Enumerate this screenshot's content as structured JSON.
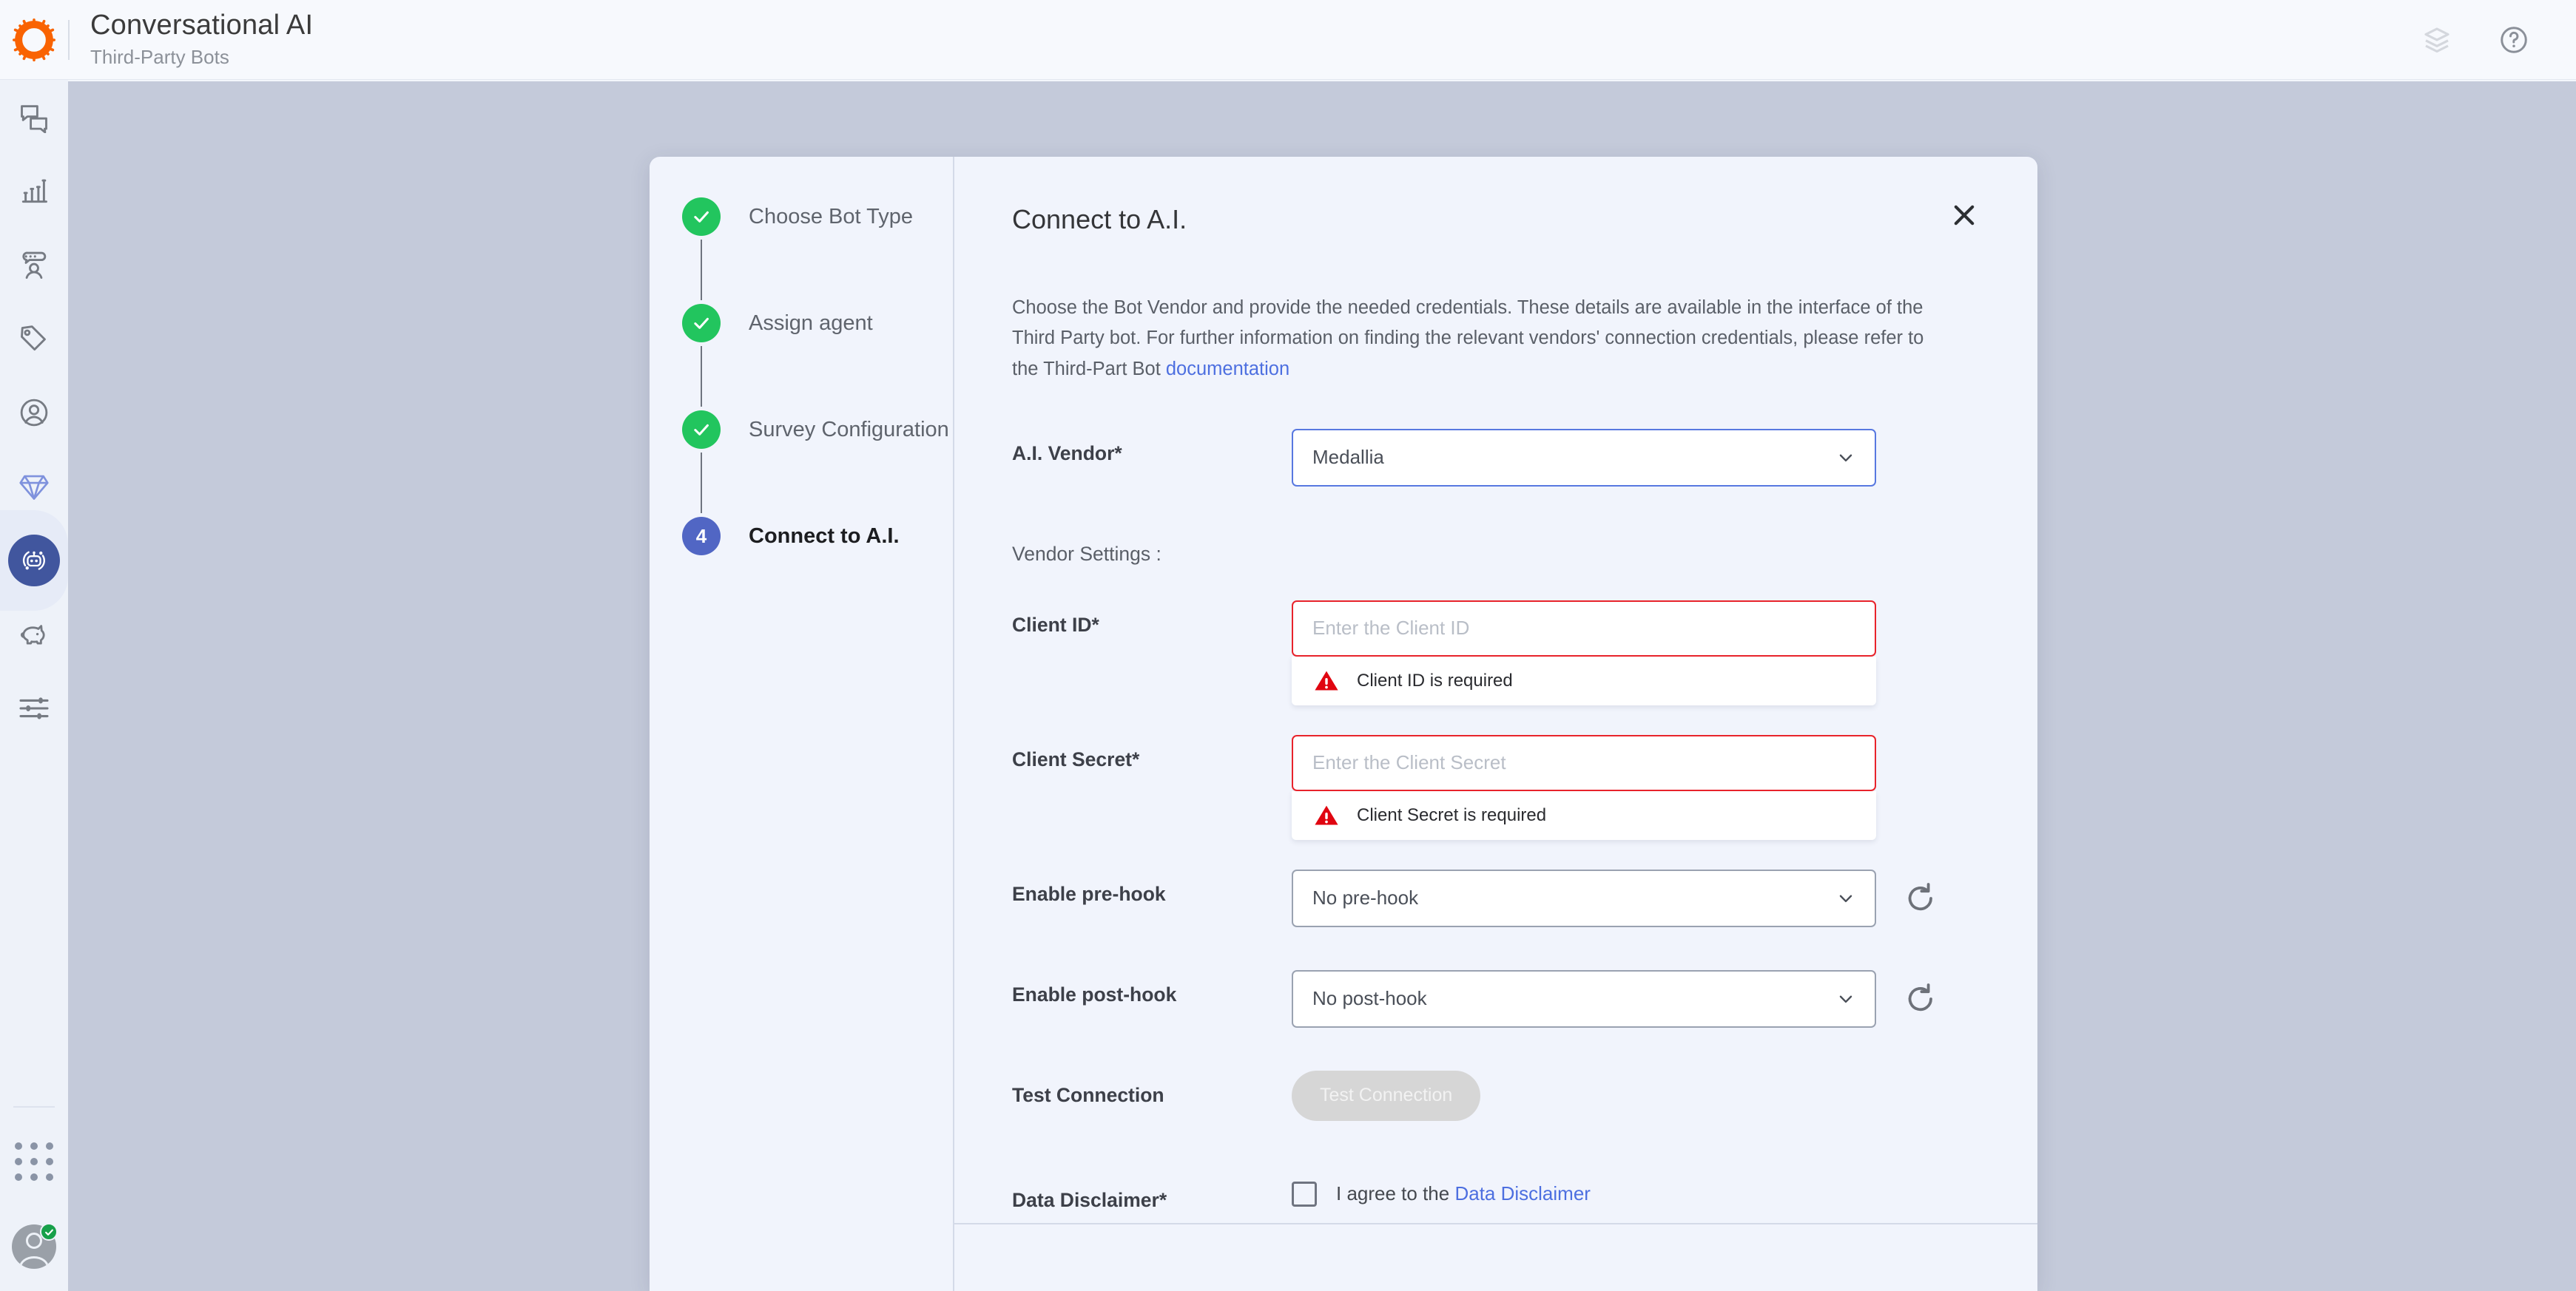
{
  "header": {
    "logo_icon": "gear-icon",
    "title": "Conversational AI",
    "subtitle": "Third-Party Bots",
    "right_icons": [
      {
        "name": "layers-icon",
        "label": "Layers"
      },
      {
        "name": "help-circle-icon",
        "label": "Help"
      }
    ]
  },
  "sidebar": {
    "items": [
      {
        "name": "chat-bubbles-icon",
        "label": "Conversations",
        "active": false
      },
      {
        "name": "bar-chart-icon",
        "label": "Analytics",
        "active": false
      },
      {
        "name": "agent-chat-icon",
        "label": "Agents",
        "active": false
      },
      {
        "name": "tag-icon",
        "label": "Tags",
        "active": false
      },
      {
        "name": "user-circle-icon",
        "label": "Users",
        "active": false
      },
      {
        "name": "diamond-icon",
        "label": "Premium",
        "active": false
      },
      {
        "name": "robot-icon",
        "label": "Conversational AI",
        "active": true
      },
      {
        "name": "pig-bank-icon",
        "label": "Campaigns",
        "active": false
      },
      {
        "name": "sliders-icon",
        "label": "Settings",
        "active": false
      }
    ],
    "apps_icon": "apps-grid-icon",
    "avatar": {
      "name": "user-avatar",
      "presence": "online"
    }
  },
  "modal": {
    "close_icon": "close-icon",
    "steps": [
      {
        "label": "Choose Bot Type",
        "state": "done",
        "badge": "✓"
      },
      {
        "label": "Assign agent",
        "state": "done",
        "badge": "✓"
      },
      {
        "label": "Survey Configuration",
        "state": "done",
        "badge": "✓"
      },
      {
        "label": "Connect to A.I.",
        "state": "current",
        "badge": "4"
      }
    ],
    "title": "Connect to A.I.",
    "description_part1": "Choose the Bot Vendor and provide the needed credentials. These details are available in the interface of the Third Party bot. For further information on finding the relevant vendors' connection credentials, please refer to the Third-Part Bot ",
    "description_link": "documentation",
    "fields": {
      "vendor_label": "A.I. Vendor*",
      "vendor_value": "Medallia",
      "vendor_settings_label": "Vendor Settings :",
      "client_id_label": "Client ID*",
      "client_id_value": "",
      "client_id_placeholder": "Enter the Client ID",
      "client_id_error": "Client ID is required",
      "client_secret_label": "Client Secret*",
      "client_secret_value": "",
      "client_secret_placeholder": "Enter the Client Secret",
      "client_secret_error": "Client Secret is required",
      "pre_hook_label": "Enable pre-hook",
      "pre_hook_value": "No pre-hook",
      "post_hook_label": "Enable post-hook",
      "post_hook_value": "No post-hook",
      "refresh_icon": "refresh-icon",
      "test_connection_label": "Test Connection",
      "test_connection_button": "Test Connection",
      "disclaimer_label": "Data Disclaimer*",
      "disclaimer_text": "I agree to the ",
      "disclaimer_link": "Data Disclaimer"
    }
  },
  "colors": {
    "brand_orange": "#f96302",
    "accent_blue": "#4d6fe0",
    "active_nav": "#41569e",
    "success_green": "#22c55e",
    "error_red": "#e8232b",
    "backdrop": "#c4cada",
    "modal_bg": "#f1f4fc"
  }
}
